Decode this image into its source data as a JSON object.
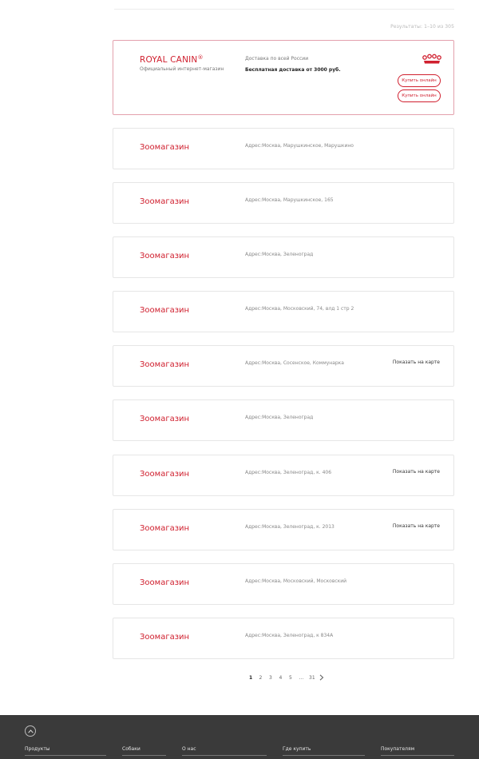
{
  "results": {
    "text": "Результаты: 1–10 из 305"
  },
  "featured": {
    "brand": "ROYAL CANIN",
    "brand_mark": "®",
    "subtitle": "Официальный интернет-магазин",
    "delivery_label": "Доставка по всей России",
    "delivery_free": "Бесплатная доставка от 3000 руб.",
    "buy_1": "Купить онлайн",
    "buy_2": "Купить онлайн",
    "icon": "royal-canin-crown-icon",
    "accent": "#d0202f"
  },
  "stores": [
    {
      "name": "Зоомагазин",
      "address": "Адрес:Москва, Марушкинское, Марушкино",
      "map": ""
    },
    {
      "name": "Зоомагазин",
      "address": "Адрес:Москва, Марушкинское, 165",
      "map": ""
    },
    {
      "name": "Зоомагазин",
      "address": "Адрес:Москва, Зеленоград",
      "map": ""
    },
    {
      "name": "Зоомагазин",
      "address": "Адрес:Москва, Московский, 74, влд 1 стр 2",
      "map": ""
    },
    {
      "name": "Зоомагазин",
      "address": "Адрес:Москва, Сосенское, Коммунарка",
      "map": "Показать на карте"
    },
    {
      "name": "Зоомагазин",
      "address": "Адрес:Москва, Зеленоград",
      "map": ""
    },
    {
      "name": "Зоомагазин",
      "address": "Адрес:Москва, Зеленоград, к. 406",
      "map": "Показать на карте"
    },
    {
      "name": "Зоомагазин",
      "address": "Адрес:Москва, Зеленоград, к. 2013",
      "map": "Показать на карте"
    },
    {
      "name": "Зоомагазин",
      "address": "Адрес:Москва, Московский, Московский",
      "map": ""
    },
    {
      "name": "Зоомагазин",
      "address": "Адрес:Москва, Зеленоград, к 834А",
      "map": ""
    }
  ],
  "pagination": {
    "pages": [
      "1",
      "2",
      "3",
      "4",
      "5",
      "...",
      "31"
    ],
    "current": "1",
    "next_icon": "chevron-right-icon"
  },
  "footer": {
    "scroll_icon": "chevron-up-icon",
    "links": [
      "Продукты",
      "Собаки",
      "О нас",
      "Где купить",
      "Покупателям"
    ]
  }
}
